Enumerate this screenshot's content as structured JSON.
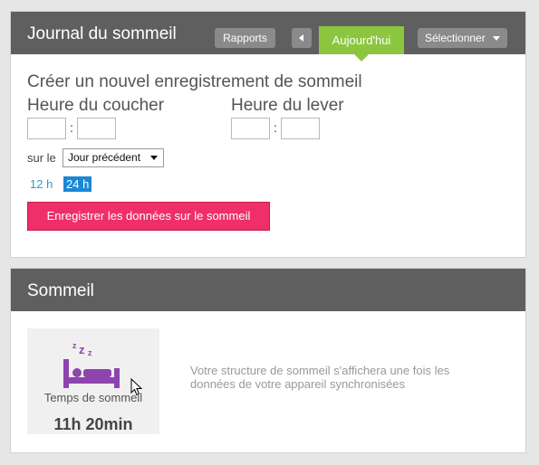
{
  "journal": {
    "title": "Journal du sommeil",
    "buttons": {
      "reports": "Rapports",
      "today": "Aujourd'hui",
      "select": "Sélectionner"
    },
    "form": {
      "heading": "Créer un nouvel enregistrement de sommeil",
      "bedtime_label": "Heure du coucher",
      "wake_label": "Heure du lever",
      "bedtime_hour": "",
      "bedtime_minute": "",
      "wake_hour": "",
      "wake_minute": "",
      "colon": ":",
      "on_label": "sur le",
      "day_selected": "Jour précédent",
      "format_12h": "12 h",
      "format_24h": "24 h",
      "format_active": "24 h",
      "save_label": "Enregistrer les données sur le sommeil"
    },
    "colors": {
      "header_bg": "#5f5f5f",
      "today_green": "#8cc63f",
      "save_pink": "#ee2f69",
      "active_blue": "#1a88d4",
      "link_blue": "#3399cc"
    }
  },
  "sleep": {
    "title": "Sommeil",
    "tile": {
      "icon": "bed-icon",
      "label": "Temps de sommeil",
      "value": "11h 20min",
      "icon_color": "#8e44ad"
    },
    "message": "Votre structure de sommeil s'affichera une fois les données de votre appareil synchronisées"
  }
}
